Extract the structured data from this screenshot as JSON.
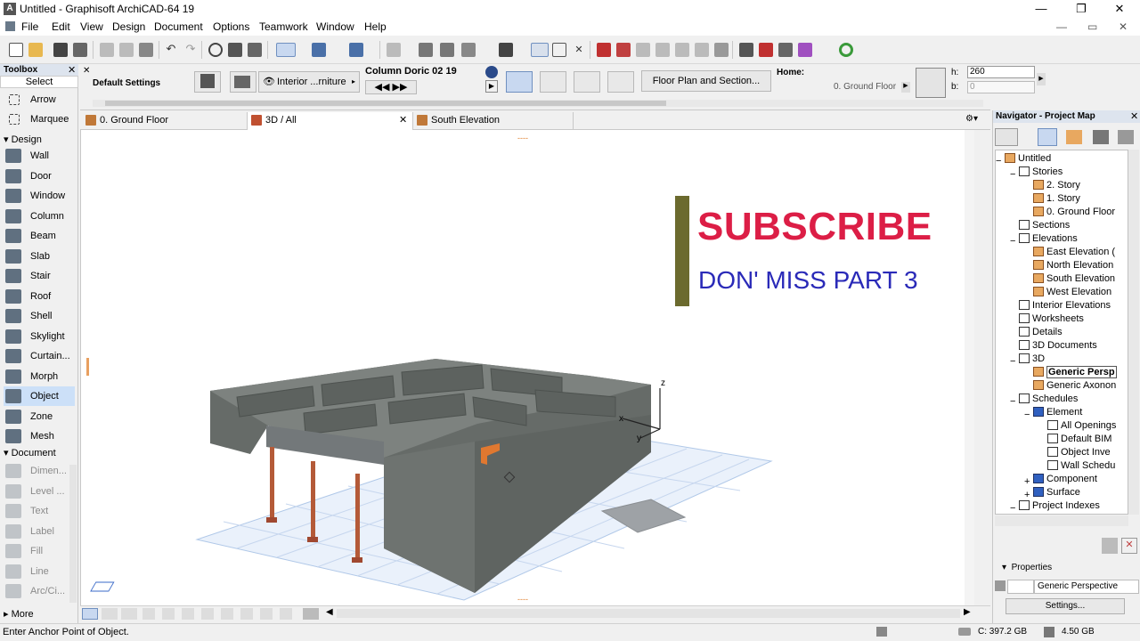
{
  "window": {
    "title": "Untitled - Graphisoft ArchiCAD-64 19",
    "app_icon_letter": "A"
  },
  "menu": [
    "File",
    "Edit",
    "View",
    "Design",
    "Document",
    "Options",
    "Teamwork",
    "Window",
    "Help"
  ],
  "toolbox": {
    "title": "Toolbox",
    "select_label": "Select",
    "select_tools": [
      "Arrow",
      "Marquee"
    ],
    "design_label": "Design",
    "design_tools": [
      "Wall",
      "Door",
      "Window",
      "Column",
      "Beam",
      "Slab",
      "Stair",
      "Roof",
      "Shell",
      "Skylight",
      "Curtain...",
      "Morph",
      "Object",
      "Zone",
      "Mesh"
    ],
    "selected_tool": "Object",
    "document_label": "Document",
    "document_tools": [
      "Dimen...",
      "Level ...",
      "Text",
      "Label",
      "Fill",
      "Line",
      "Arc/Ci..."
    ],
    "more_label": "More"
  },
  "infobox": {
    "default_settings": "Default Settings",
    "layer_label": "Interior ...rniture",
    "object_name": "Column Doric 02 19",
    "floor_plan_button": "Floor Plan and Section...",
    "home_label": "Home:",
    "home_story": "0. Ground Floor",
    "h_label": "h:",
    "h_value": "260",
    "b_label": "b:",
    "b_value": "0"
  },
  "tabs": [
    {
      "label": "0. Ground Floor",
      "active": false
    },
    {
      "label": "3D / All",
      "active": true
    },
    {
      "label": "South Elevation",
      "active": false
    }
  ],
  "overlay": {
    "subscribe": "SUBSCRIBE",
    "subtitle": "DON' MISS PART 3",
    "subscribe_color": "#dc1e46",
    "subtitle_color": "#2a2ab8",
    "bar_color": "#6b6a2e"
  },
  "axes": {
    "z": "z",
    "x": "x",
    "y": "y"
  },
  "navigator": {
    "title": "Navigator - Project Map",
    "tree": [
      {
        "label": "Untitled",
        "level": 0,
        "icon": "folder"
      },
      {
        "label": "Stories",
        "level": 1,
        "icon": "box"
      },
      {
        "label": "2. Story",
        "level": 2,
        "icon": "folder"
      },
      {
        "label": "1. Story",
        "level": 2,
        "icon": "folder"
      },
      {
        "label": "0. Ground Floor",
        "level": 2,
        "icon": "folder"
      },
      {
        "label": "Sections",
        "level": 1,
        "icon": "box"
      },
      {
        "label": "Elevations",
        "level": 1,
        "icon": "box"
      },
      {
        "label": "East Elevation (",
        "level": 2,
        "icon": "folder"
      },
      {
        "label": "North Elevation",
        "level": 2,
        "icon": "folder"
      },
      {
        "label": "South Elevation",
        "level": 2,
        "icon": "folder"
      },
      {
        "label": "West Elevation",
        "level": 2,
        "icon": "folder"
      },
      {
        "label": "Interior Elevations",
        "level": 1,
        "icon": "box"
      },
      {
        "label": "Worksheets",
        "level": 1,
        "icon": "box"
      },
      {
        "label": "Details",
        "level": 1,
        "icon": "box"
      },
      {
        "label": "3D Documents",
        "level": 1,
        "icon": "box"
      },
      {
        "label": "3D",
        "level": 1,
        "icon": "box"
      },
      {
        "label": "Generic Persp",
        "level": 2,
        "icon": "folder"
      },
      {
        "label": "Generic Axonon",
        "level": 2,
        "icon": "folder"
      },
      {
        "label": "Schedules",
        "level": 1,
        "icon": "box"
      },
      {
        "label": "Element",
        "level": 2,
        "icon": "blue"
      },
      {
        "label": "All Openings",
        "level": 3,
        "icon": "box"
      },
      {
        "label": "Default BIM",
        "level": 3,
        "icon": "box"
      },
      {
        "label": "Object Inve",
        "level": 3,
        "icon": "box"
      },
      {
        "label": "Wall Schedu",
        "level": 3,
        "icon": "box"
      },
      {
        "label": "Component",
        "level": 2,
        "icon": "blue"
      },
      {
        "label": "Surface",
        "level": 2,
        "icon": "blue"
      },
      {
        "label": "Project Indexes",
        "level": 1,
        "icon": "box"
      }
    ],
    "selected_item": "Generic Persp",
    "properties_label": "Properties",
    "properties_value": "Generic Perspective",
    "settings_button": "Settings..."
  },
  "status": {
    "message": "Enter Anchor Point of Object.",
    "disk": "C: 397.2 GB",
    "memory": "4.50 GB"
  }
}
